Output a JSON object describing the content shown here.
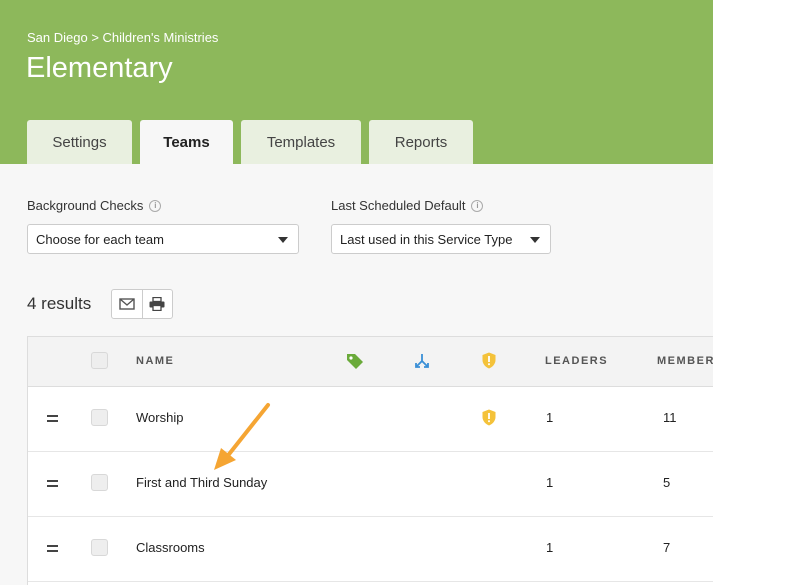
{
  "header": {
    "breadcrumb": "San Diego > Children's Ministries",
    "title": "Elementary",
    "tabs": [
      {
        "label": "Settings",
        "active": false
      },
      {
        "label": "Teams",
        "active": true
      },
      {
        "label": "Templates",
        "active": false
      },
      {
        "label": "Reports",
        "active": false
      }
    ]
  },
  "filters": {
    "background_checks": {
      "label": "Background Checks",
      "value": "Choose for each team"
    },
    "last_scheduled": {
      "label": "Last Scheduled Default",
      "value": "Last used in this Service Type"
    }
  },
  "results": {
    "count_label": "4 results"
  },
  "table": {
    "columns": {
      "name": "NAME",
      "leaders": "LEADERS",
      "members": "MEMBERS"
    },
    "rows": [
      {
        "name": "Worship",
        "leaders": "1",
        "members": "11",
        "has_check": true
      },
      {
        "name": "First and Third Sunday",
        "leaders": "1",
        "members": "5",
        "has_check": false
      },
      {
        "name": "Classrooms",
        "leaders": "1",
        "members": "7",
        "has_check": false
      }
    ]
  },
  "colors": {
    "header_green": "#8db85b",
    "tag_green": "#6aaa3a",
    "split_blue": "#3a8fd6",
    "shield_yellow": "#f4c23a",
    "arrow_orange": "#f5a533"
  }
}
